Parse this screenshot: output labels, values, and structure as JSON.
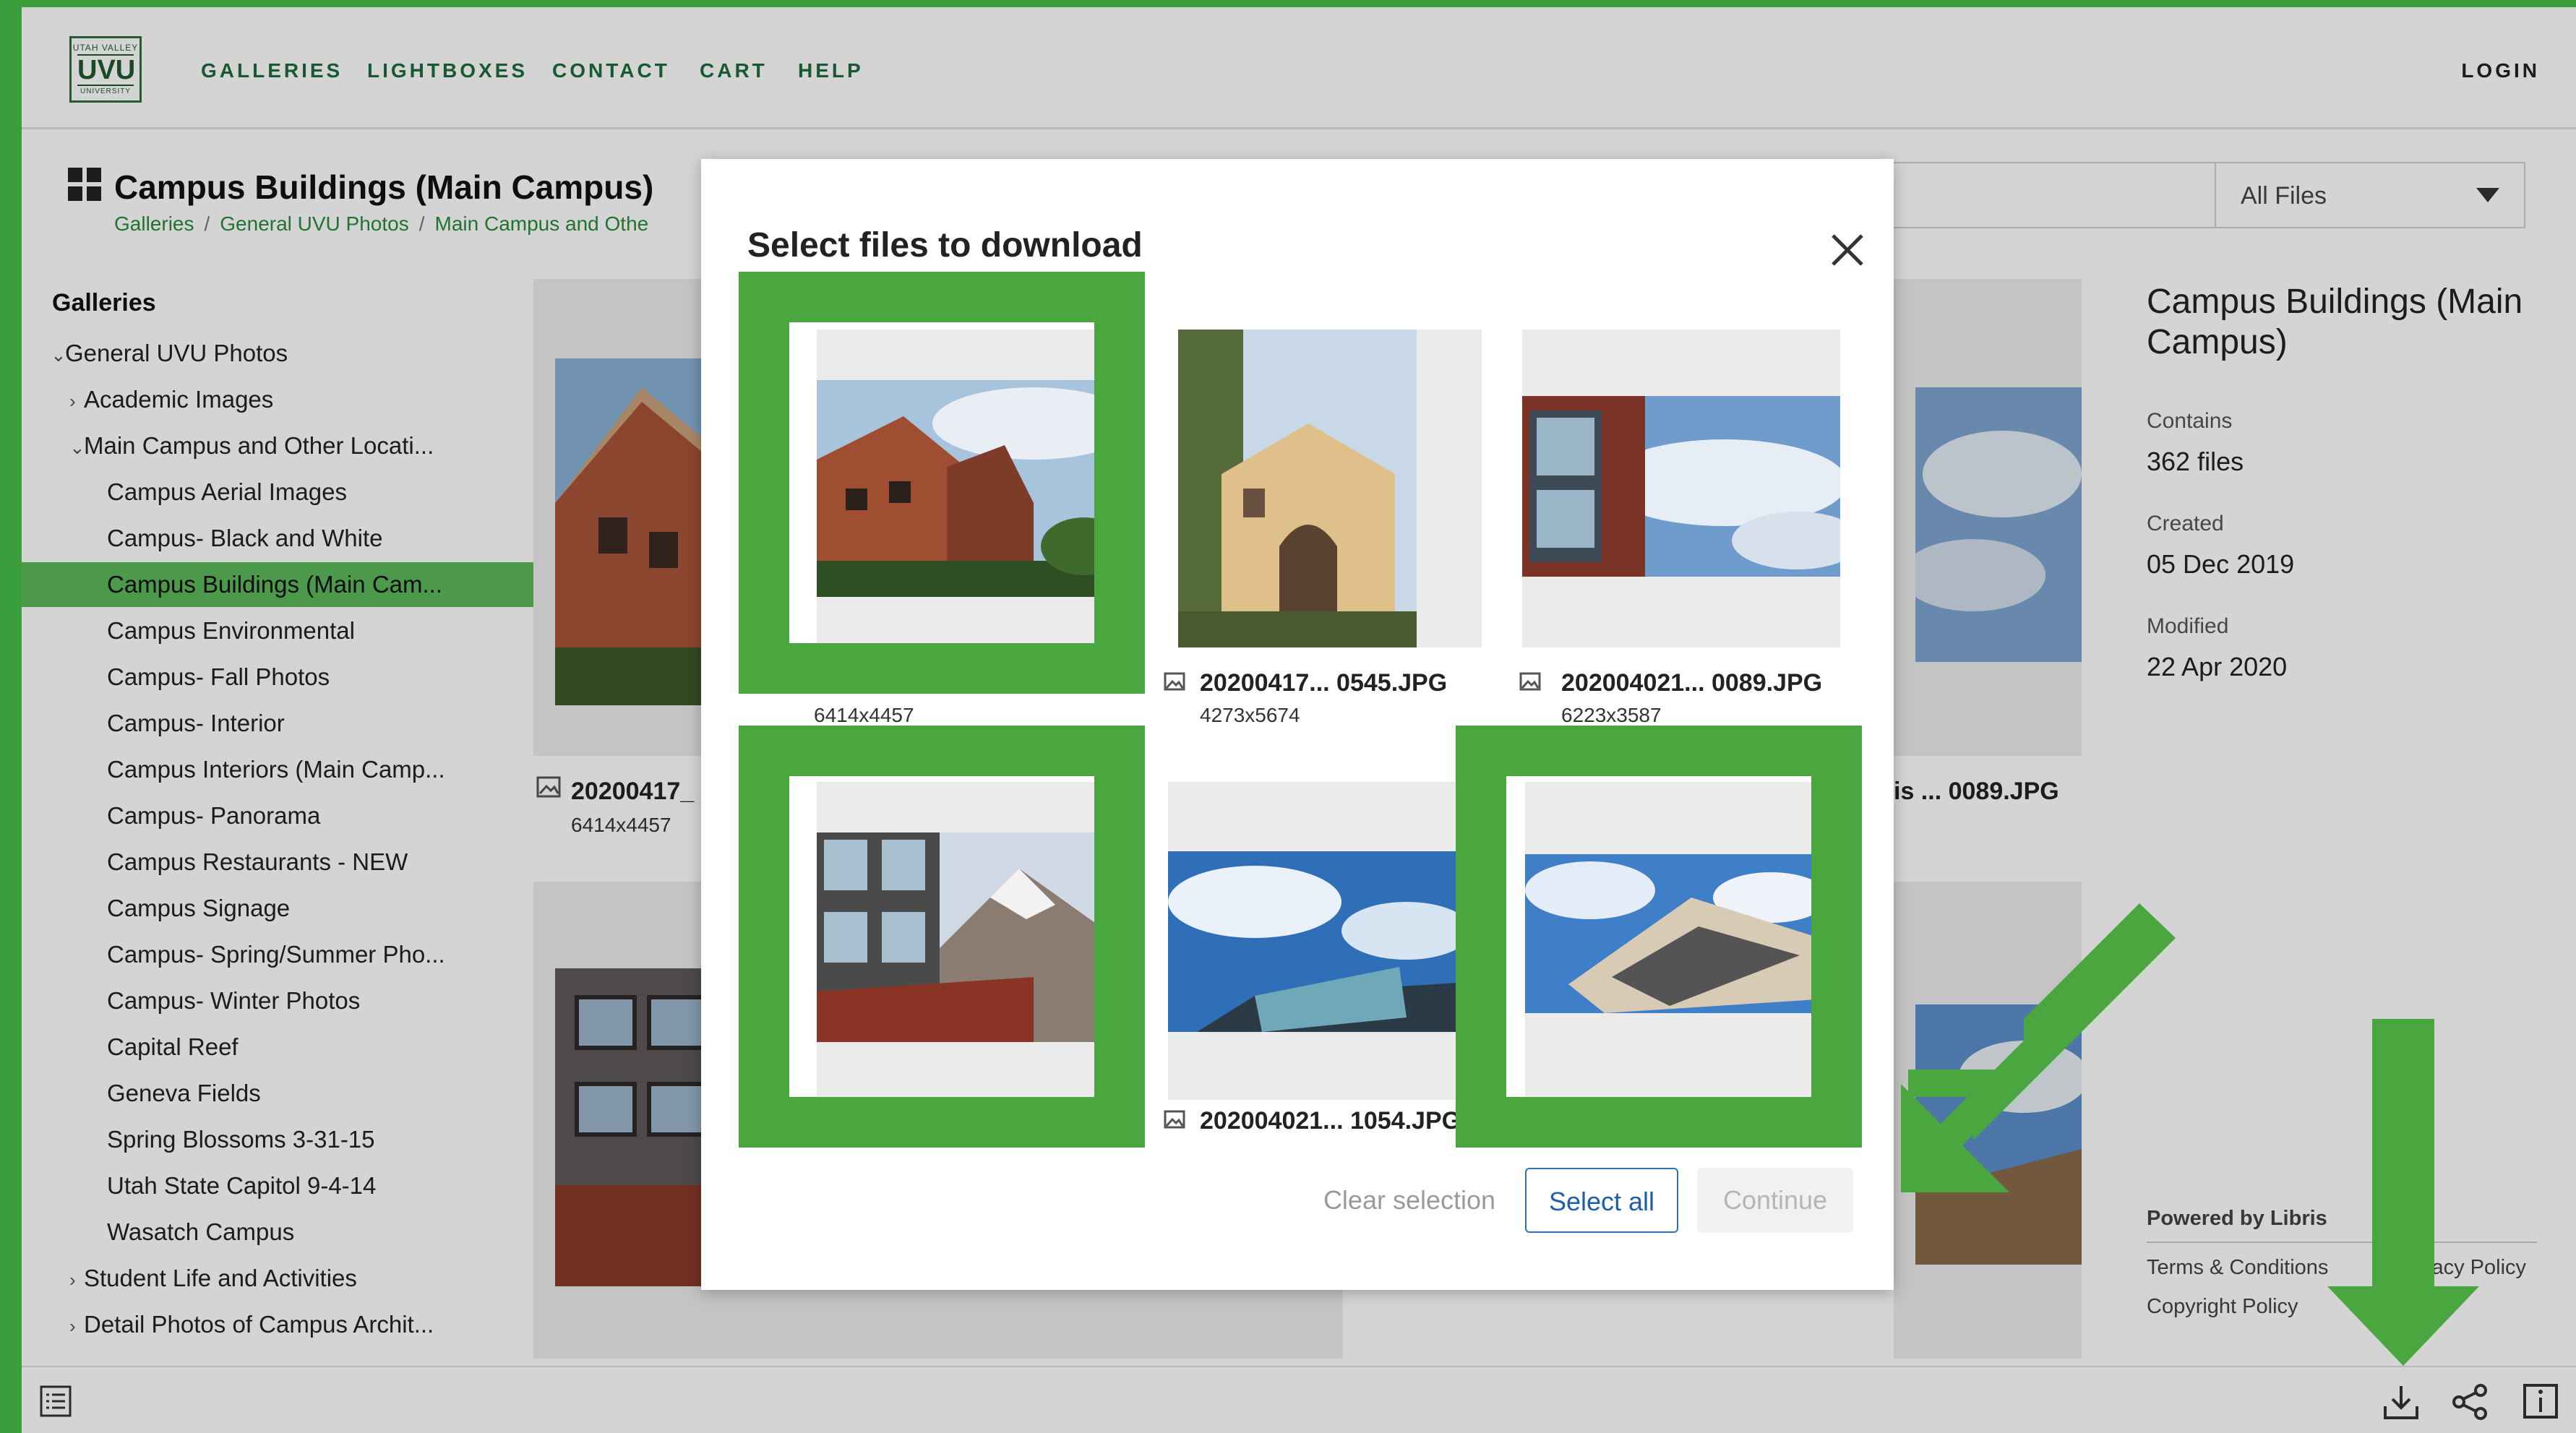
{
  "header": {
    "logo": {
      "top": "UTAH VALLEY",
      "main": "UVU",
      "bottom": "UNIVERSITY"
    },
    "nav": [
      "GALLERIES",
      "LIGHTBOXES",
      "CONTACT",
      "CART",
      "HELP"
    ],
    "login": "LOGIN"
  },
  "page": {
    "title": "Campus Buildings (Main Campus)",
    "breadcrumbs": [
      "Galleries",
      "General UVU Photos",
      "Main Campus and Othe"
    ],
    "file_filter": "All Files"
  },
  "sidebar": {
    "heading": "Galleries",
    "items": [
      {
        "label": "General UVU Photos",
        "chev": "⌄"
      },
      {
        "label": "Academic Images",
        "chev": "›"
      },
      {
        "label": "Main Campus and Other Locati...",
        "chev": "⌄"
      },
      {
        "label": "Campus Aerial Images",
        "chev": ""
      },
      {
        "label": "Campus- Black and White",
        "chev": ""
      },
      {
        "label": "Campus Buildings (Main Cam...",
        "chev": ""
      },
      {
        "label": "Campus Environmental",
        "chev": ""
      },
      {
        "label": "Campus- Fall Photos",
        "chev": ""
      },
      {
        "label": "Campus- Interior",
        "chev": ""
      },
      {
        "label": "Campus Interiors (Main Camp...",
        "chev": ""
      },
      {
        "label": "Campus- Panorama",
        "chev": ""
      },
      {
        "label": "Campus Restaurants - NEW",
        "chev": ""
      },
      {
        "label": "Campus Signage",
        "chev": ""
      },
      {
        "label": "Campus- Spring/Summer Pho...",
        "chev": ""
      },
      {
        "label": "Campus- Winter Photos",
        "chev": ""
      },
      {
        "label": "Capital Reef",
        "chev": ""
      },
      {
        "label": "Geneva Fields",
        "chev": ""
      },
      {
        "label": "Spring Blossoms 3-31-15",
        "chev": ""
      },
      {
        "label": "Utah State Capitol 9-4-14",
        "chev": ""
      },
      {
        "label": "Wasatch Campus",
        "chev": ""
      },
      {
        "label": "Student Life and Activities",
        "chev": "›"
      },
      {
        "label": "Detail Photos of Campus Archit...",
        "chev": "›"
      }
    ]
  },
  "info": {
    "title": "Campus Buildings (Main Campus)",
    "contains_label": "Contains",
    "contains": "362 files",
    "created_label": "Created",
    "created": "05 Dec 2019",
    "modified_label": "Modified",
    "modified": "22 Apr 2020",
    "powered": "Powered by Libris",
    "terms": "Terms & Conditions",
    "privacy": "vacy Policy",
    "copyright": "Copyright Policy"
  },
  "background_grid": {
    "file1_name": "20200417_",
    "file1_dims": "6414x4457",
    "file2_name": "is ... 0089.JPG"
  },
  "modal": {
    "title": "Select files to download",
    "files": [
      {
        "name": "",
        "dims": "6414x4457"
      },
      {
        "name": "20200417... 0545.JPG",
        "dims": "4273x5674"
      },
      {
        "name": "202004021... 0089.JPG",
        "dims": "6223x3587"
      },
      {
        "name": "",
        "dims": ""
      },
      {
        "name": "202004021... 1054.JPG",
        "dims": ""
      },
      {
        "name": "",
        "dims": ""
      }
    ],
    "clear_label": "Clear selection",
    "select_all_label": "Select all",
    "continue_label": "Continue"
  },
  "colors": {
    "highlight": "#4aa63f",
    "brand_green": "#1e6b3b",
    "selected_row": "#5cb85c",
    "button_blue": "#1d5fae"
  }
}
